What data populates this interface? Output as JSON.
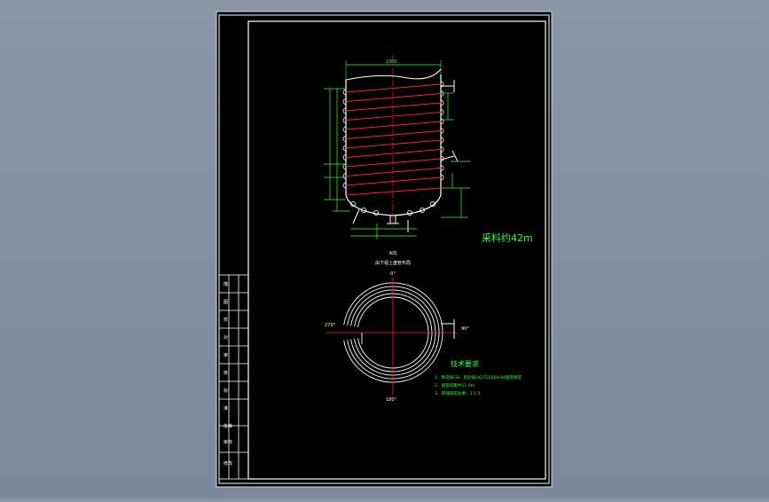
{
  "colors": {
    "canvas_bg": "#7c889b",
    "sheet": "#000000",
    "frame": "#ffffff",
    "coil": "#ff2020",
    "dimension": "#33ff33",
    "axis": "#ff2020",
    "text_green": "#33ff33",
    "text_white": "#ffffff"
  },
  "drawing": {
    "coil_length_label": "采料约42m",
    "top_dim_label": "1300",
    "section_view_label": "A向",
    "section_view_sublabel": "由下视上盘管布局",
    "section_top_label": "0°",
    "section_left_label": "270°",
    "section_right_label": "90°",
    "section_bottom_label": "180°",
    "tech_title": "技术要求",
    "tech_lines": [
      "1、制造按GB、检验按HG/T20569-94盘管规定",
      "2、盘管间距约11.0m",
      "3、焊缝探伤比例：1:1.5"
    ]
  },
  "title_block": {
    "cells": [
      "描",
      "图",
      "校",
      "对",
      "审",
      "核",
      "标",
      "准",
      "批准"
    ],
    "bottom_cells": [
      "审核",
      "修改"
    ]
  }
}
